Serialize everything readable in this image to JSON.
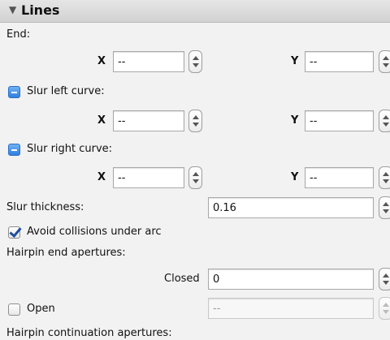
{
  "section": {
    "title": "Lines",
    "collapse_glyph": "▼"
  },
  "end": {
    "label": "End:",
    "x_label": "X",
    "x_value": "--",
    "y_label": "Y",
    "y_value": "--"
  },
  "slur_left": {
    "label": "Slur left curve:",
    "x_label": "X",
    "x_value": "--",
    "y_label": "Y",
    "y_value": "--"
  },
  "slur_right": {
    "label": "Slur right curve:",
    "x_label": "X",
    "x_value": "--",
    "y_label": "Y",
    "y_value": "--"
  },
  "slur_thickness": {
    "label": "Slur thickness:",
    "value": "0.16"
  },
  "avoid_collisions": {
    "label": "Avoid collisions under arc",
    "checked": true
  },
  "hairpin_end": {
    "label": "Hairpin end apertures:",
    "closed_label": "Closed",
    "closed_value": "0",
    "open_label": "Open",
    "open_value": "--"
  },
  "hairpin_continuation": {
    "label": "Hairpin continuation apertures:"
  },
  "colors": {
    "checkbox_accent": "#2f7fe0",
    "header_bg": "#d9d9d9"
  }
}
